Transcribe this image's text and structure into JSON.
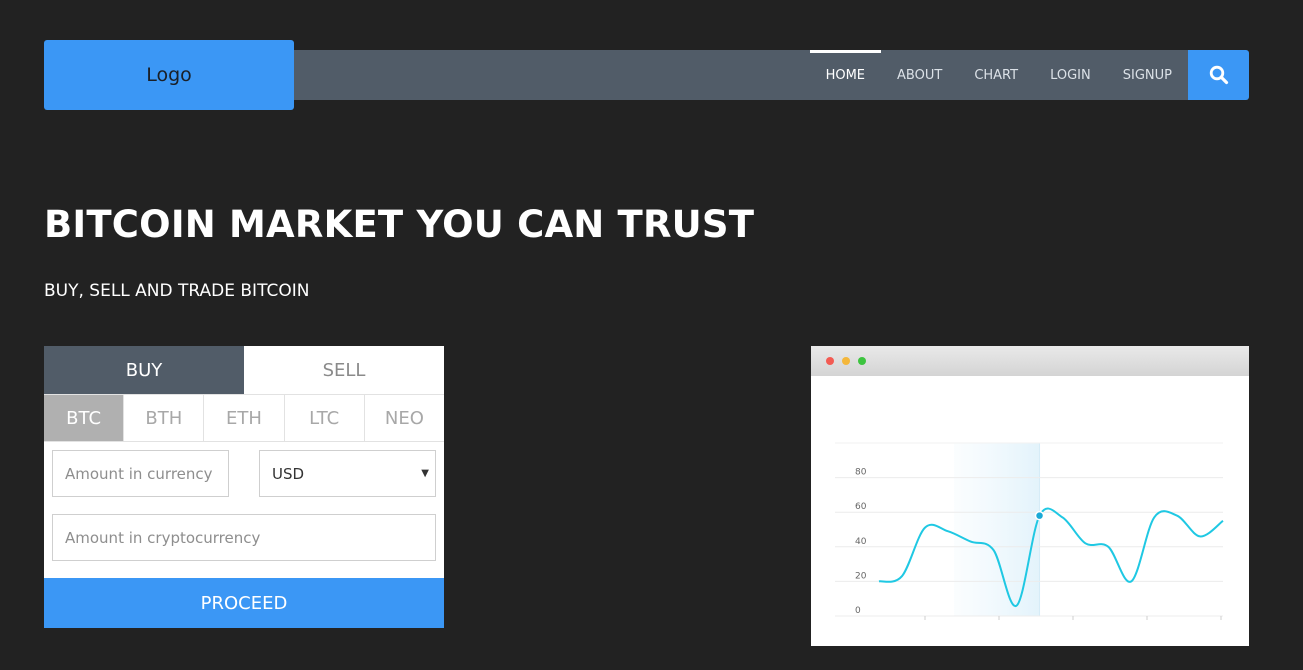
{
  "header": {
    "logo": "Logo",
    "nav": [
      {
        "label": "HOME",
        "active": true
      },
      {
        "label": "ABOUT",
        "active": false
      },
      {
        "label": "CHART",
        "active": false
      },
      {
        "label": "LOGIN",
        "active": false
      },
      {
        "label": "SIGNUP",
        "active": false
      }
    ],
    "search_icon": "search-icon"
  },
  "hero": {
    "title": "BITCOIN MARKET YOU CAN TRUST",
    "subtitle": "BUY, SELL AND TRADE BITCOIN"
  },
  "trade_widget": {
    "tabs": [
      {
        "label": "BUY",
        "active": true
      },
      {
        "label": "SELL",
        "active": false
      }
    ],
    "coins": [
      {
        "label": "BTC",
        "selected": true
      },
      {
        "label": "BTH",
        "selected": false
      },
      {
        "label": "ETH",
        "selected": false
      },
      {
        "label": "LTC",
        "selected": false
      },
      {
        "label": "NEO",
        "selected": false
      }
    ],
    "amount_placeholder": "Amount in currency",
    "currency_selected": "USD",
    "crypto_placeholder": "Amount in cryptocurrency",
    "proceed_label": "PROCEED"
  },
  "colors": {
    "background": "#222222",
    "accent": "#3b97f5",
    "navbar": "#515c68",
    "line": "#1fc8e3"
  },
  "chart_data": {
    "type": "line",
    "ylim": [
      0,
      100
    ],
    "yticks": [
      0,
      20,
      40,
      60,
      80
    ],
    "x": [
      0,
      1,
      2,
      3,
      4,
      5,
      6,
      7,
      8,
      9,
      10,
      11,
      12,
      13,
      14,
      15
    ],
    "values": [
      20,
      23,
      51,
      49,
      43,
      38,
      6,
      58,
      57,
      42,
      40,
      20,
      57,
      58,
      46,
      55
    ],
    "highlight_index": 7,
    "grid": true
  }
}
